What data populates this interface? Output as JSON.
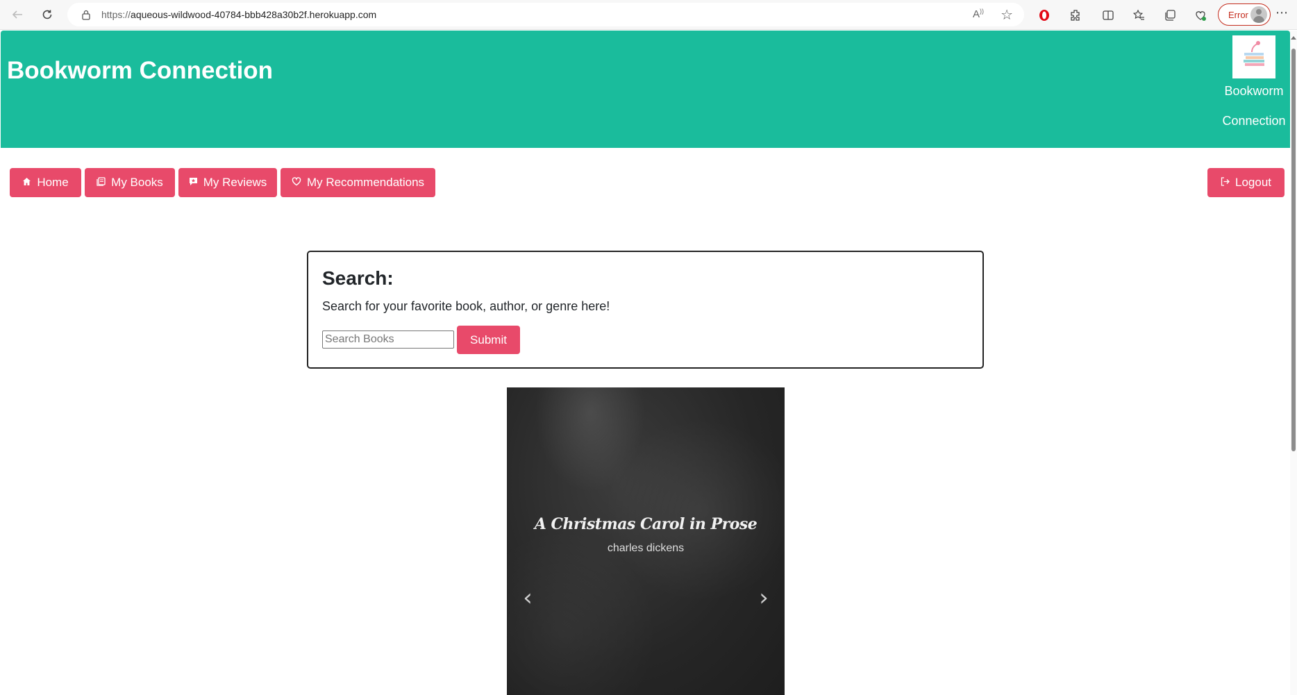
{
  "browser": {
    "url_prefix": "https://",
    "url_host": "aqueous-wildwood-40784-bbb428a30b2f.herokuapp.com",
    "error_label": "Error",
    "icons": [
      "back-icon",
      "reload-icon",
      "lock-icon",
      "read-aloud-icon",
      "favorite-star-icon",
      "opera-icon",
      "extensions-icon",
      "split-screen-icon",
      "favorites-icon",
      "collections-icon",
      "performance-icon",
      "profile-avatar-icon",
      "more-icon"
    ]
  },
  "header": {
    "title": "Bookworm Connection",
    "logo_label_line1": "Bookworm",
    "logo_label_line2": "Connection"
  },
  "nav": {
    "home": "Home",
    "my_books": "My Books",
    "my_reviews": "My Reviews",
    "my_recommendations": "My Recommendations",
    "logout": "Logout"
  },
  "search": {
    "heading": "Search:",
    "description": "Search for your favorite book, author, or genre here!",
    "placeholder": "Search Books",
    "value": "",
    "submit_label": "Submit"
  },
  "carousel": {
    "book_title": "A Christmas Carol in Prose",
    "book_author": "charles dickens",
    "prev_glyph": "‹",
    "next_glyph": "›"
  },
  "colors": {
    "header_bg": "#1abc9c",
    "button_bg": "#e84a6a",
    "error": "#c42b1c"
  }
}
